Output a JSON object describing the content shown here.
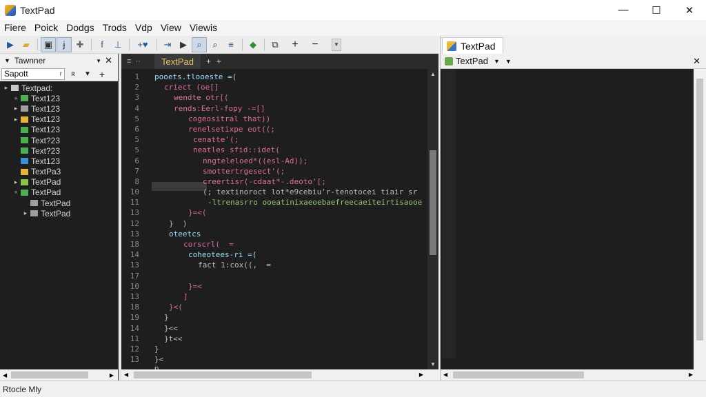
{
  "window": {
    "title": "TextPad",
    "controls": [
      "—",
      "☐",
      "✕"
    ]
  },
  "menu": [
    "Fiere",
    "Poick",
    "Dodgs",
    "Trods",
    "Vdp",
    "View",
    "Viewis"
  ],
  "left_panel": {
    "title": "Tawnner",
    "filter_value": "Sapott",
    "tree": [
      {
        "label": "Textpad:",
        "color": "#c8c8c8",
        "twisty": "▸"
      },
      {
        "label": "Text123",
        "color": "#4caf50",
        "twisty": "+"
      },
      {
        "label": "Text123",
        "color": "#9e9e9e",
        "twisty": "▸"
      },
      {
        "label": "Text123",
        "color": "#e5b43b",
        "twisty": "▸"
      },
      {
        "label": "Text123",
        "color": "#4caf50",
        "twisty": ""
      },
      {
        "label": "Text?23",
        "color": "#4caf50",
        "twisty": ""
      },
      {
        "label": "Text?23",
        "color": "#4caf50",
        "twisty": ""
      },
      {
        "label": "Text123",
        "color": "#3b8fd6",
        "twisty": ""
      },
      {
        "label": "TextPa3",
        "color": "#e5b43b",
        "twisty": ""
      },
      {
        "label": "TextPad",
        "color": "#8bc34a",
        "twisty": "▸"
      },
      {
        "label": "TextPad",
        "color": "#4caf50",
        "twisty": "+"
      },
      {
        "label": "TextPad",
        "color": "#9e9e9e",
        "twisty": ""
      },
      {
        "label": "TextPad",
        "color": "#9e9e9e",
        "twisty": "▸"
      }
    ]
  },
  "editor": {
    "tab_label": "TextPad",
    "line_numbers": [
      "1",
      "2",
      "3",
      "4",
      "5",
      "6",
      "5",
      "5",
      "6",
      "7",
      "8",
      "10",
      "11",
      "13",
      "12",
      "13",
      "18",
      "14",
      "13",
      "17",
      "10",
      "13",
      "18",
      "19",
      "14",
      "11",
      "12",
      "13",
      ""
    ],
    "lines": [
      {
        "indent": 0,
        "text": "pooets.tlooeste =(",
        "cls": "c-blue"
      },
      {
        "indent": 2,
        "text": "criect (oe[]",
        "cls": "c-pink"
      },
      {
        "indent": 4,
        "text": "wendte otr[(",
        "cls": "c-pink"
      },
      {
        "indent": 4,
        "text": "rends:Eerl-fopy -=[]",
        "cls": "c-pink"
      },
      {
        "indent": 7,
        "text": "cogeositral that))",
        "cls": "c-pink"
      },
      {
        "indent": 7,
        "text": "renelsetixpe eot((;",
        "cls": "c-pink"
      },
      {
        "indent": 8,
        "text": "cenatte'(;",
        "cls": "c-pink"
      },
      {
        "indent": 8,
        "text": "neatles sfid::idet(",
        "cls": "c-pink"
      },
      {
        "indent": 10,
        "text": "nngteleloed*((esl-Ad));",
        "cls": "c-pink"
      },
      {
        "indent": 10,
        "text": "smottertrgesect'(;",
        "cls": "c-pink"
      },
      {
        "indent": 10,
        "text": "creertisr(-cdaat*-.deoto'[;",
        "cls": "c-pink"
      },
      {
        "indent": 10,
        "text": "(; textinoroct lot*e9cebiu'r-tenotocei tiair sr",
        "cls": "c-gray"
      },
      {
        "indent": 11,
        "text": "-ltrenasrro ooeatinixaeoebaefreecaeiteirtisaooe",
        "cls": "c-grn"
      },
      {
        "indent": 7,
        "text": "}=<(",
        "cls": "c-pink"
      },
      {
        "indent": 3,
        "text": "}  )",
        "cls": "c-gray"
      },
      {
        "indent": 3,
        "text": "oteetcs",
        "cls": "c-blue"
      },
      {
        "indent": 6,
        "text": "corscrl(  =",
        "cls": "c-pink"
      },
      {
        "indent": 7,
        "text": "coheotees-ri =(",
        "cls": "c-blue"
      },
      {
        "indent": 9,
        "text": "fact 1:cox((,  =",
        "cls": "c-gray"
      },
      {
        "indent": 0,
        "text": "",
        "cls": "c-gray"
      },
      {
        "indent": 7,
        "text": "}=<",
        "cls": "c-pink"
      },
      {
        "indent": 6,
        "text": "]",
        "cls": "c-pink"
      },
      {
        "indent": 3,
        "text": "}<(",
        "cls": "c-pink"
      },
      {
        "indent": 2,
        "text": "}",
        "cls": "c-gray"
      },
      {
        "indent": 2,
        "text": "}<<",
        "cls": "c-gray"
      },
      {
        "indent": 2,
        "text": "}t<<",
        "cls": "c-gray"
      },
      {
        "indent": 0,
        "text": "}",
        "cls": "c-gray"
      },
      {
        "indent": 0,
        "text": "}<",
        "cls": "c-gray"
      },
      {
        "indent": 0,
        "text": "D",
        "cls": "c-gray"
      }
    ]
  },
  "right_pane": {
    "tab_label": "TextPad",
    "sub_label": "TextPad"
  },
  "status": {
    "text": "Rtocle Mly"
  }
}
